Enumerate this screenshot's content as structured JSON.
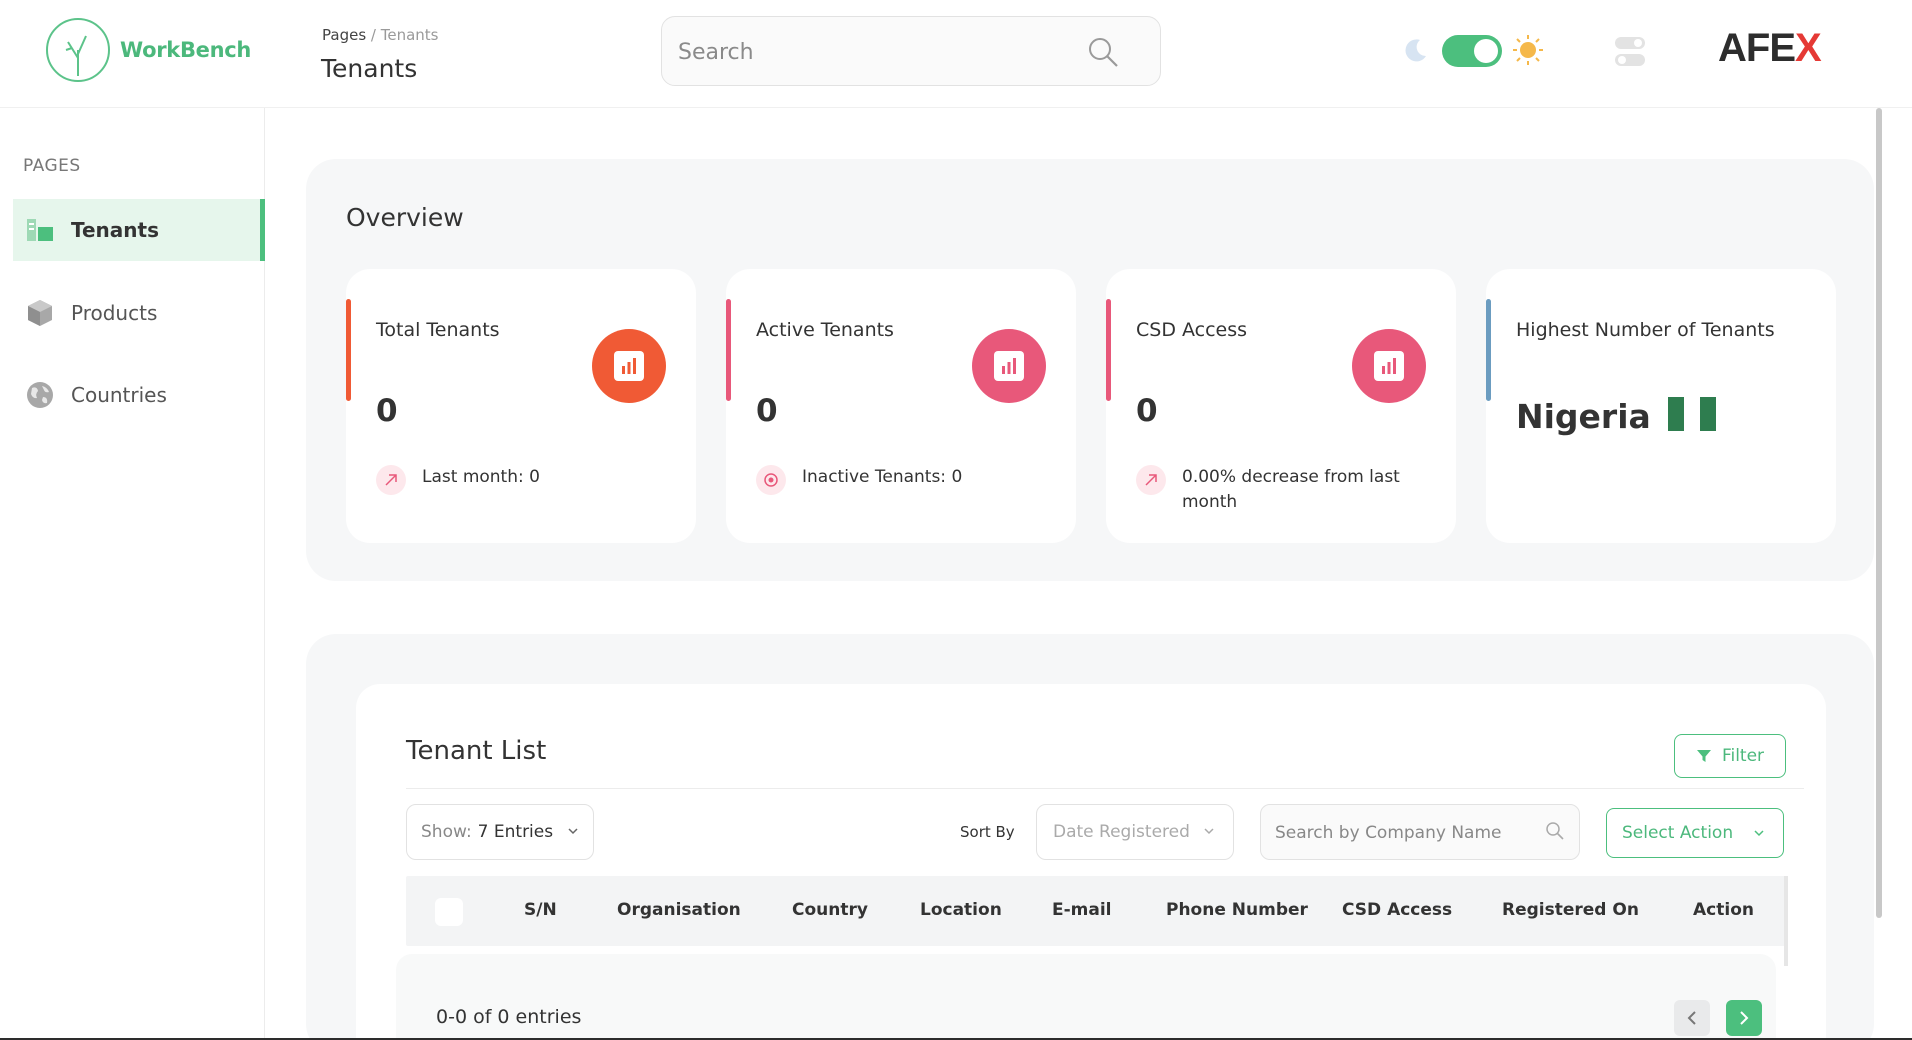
{
  "brand": {
    "logo_text": "WorkBench",
    "company_left": "AFE",
    "company_x": "X"
  },
  "header": {
    "breadcrumb_root": "Pages",
    "breadcrumb_sep": " / ",
    "breadcrumb_current": "Tenants",
    "page_title": "Tenants",
    "search_placeholder": "Search",
    "theme_toggle_on": true
  },
  "sidebar": {
    "section_title": "PAGES",
    "items": [
      {
        "label": "Tenants",
        "icon": "tenants-icon",
        "active": true
      },
      {
        "label": "Products",
        "icon": "products-icon",
        "active": false
      },
      {
        "label": "Countries",
        "icon": "globe-icon",
        "active": false
      }
    ]
  },
  "overview": {
    "title": "Overview",
    "cards": [
      {
        "title": "Total Tenants",
        "value": "0",
        "footer": "Last month: 0",
        "accent": "#f05a35",
        "icon": "chart-icon"
      },
      {
        "title": "Active Tenants",
        "value": "0",
        "footer": "Inactive Tenants: 0",
        "accent": "#e8587a",
        "icon": "chart-icon"
      },
      {
        "title": "CSD Access",
        "value": "0",
        "footer": "0.00% decrease from last month",
        "accent": "#e8587a",
        "icon": "chart-icon"
      },
      {
        "title": "Highest Number of Tenants",
        "country": "Nigeria",
        "accent": "#6b9cc0",
        "flag": [
          "#2e7d4f",
          "#ffffff",
          "#2e7d4f"
        ]
      }
    ]
  },
  "tenant_list": {
    "title": "Tenant List",
    "filter_label": "Filter",
    "show_label": "Show:",
    "show_value": "7 Entries",
    "sort_by_label": "Sort By",
    "sort_value": "Date Registered",
    "company_search_placeholder": "Search by Company Name",
    "action_label": "Select Action",
    "columns": [
      "S/N",
      "Organisation",
      "Country",
      "Location",
      "E-mail",
      "Phone Number",
      "CSD Access",
      "Registered On",
      "Action"
    ],
    "entries_text": "0-0 of 0 entries"
  },
  "colors": {
    "primary": "#4cbf7e",
    "orange": "#f05a35",
    "pink": "#e8587a"
  }
}
